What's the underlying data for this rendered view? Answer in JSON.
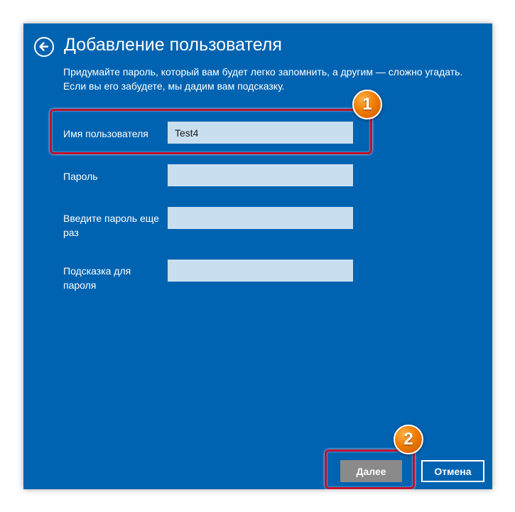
{
  "header": {
    "title": "Добавление пользователя",
    "back_icon": "arrow-left-circle-icon"
  },
  "description": "Придумайте пароль, который вам будет легко запомнить, а другим — сложно угадать. Если вы его забудете, мы дадим вам подсказку.",
  "form": {
    "username": {
      "label": "Имя пользователя",
      "value": "Test4"
    },
    "password": {
      "label": "Пароль",
      "value": ""
    },
    "password_confirm": {
      "label": "Введите пароль еще раз",
      "value": ""
    },
    "hint": {
      "label": "Подсказка для пароля",
      "value": ""
    }
  },
  "buttons": {
    "next_label": "Далее",
    "cancel_label": "Отмена"
  },
  "annotations": {
    "marker_1": "1",
    "marker_2": "2"
  },
  "colors": {
    "background": "#0063b1",
    "input_bg": "#c9dff0",
    "highlight": "#c01030",
    "marker": "#f07d00",
    "next_button": "#8a8a8a"
  }
}
